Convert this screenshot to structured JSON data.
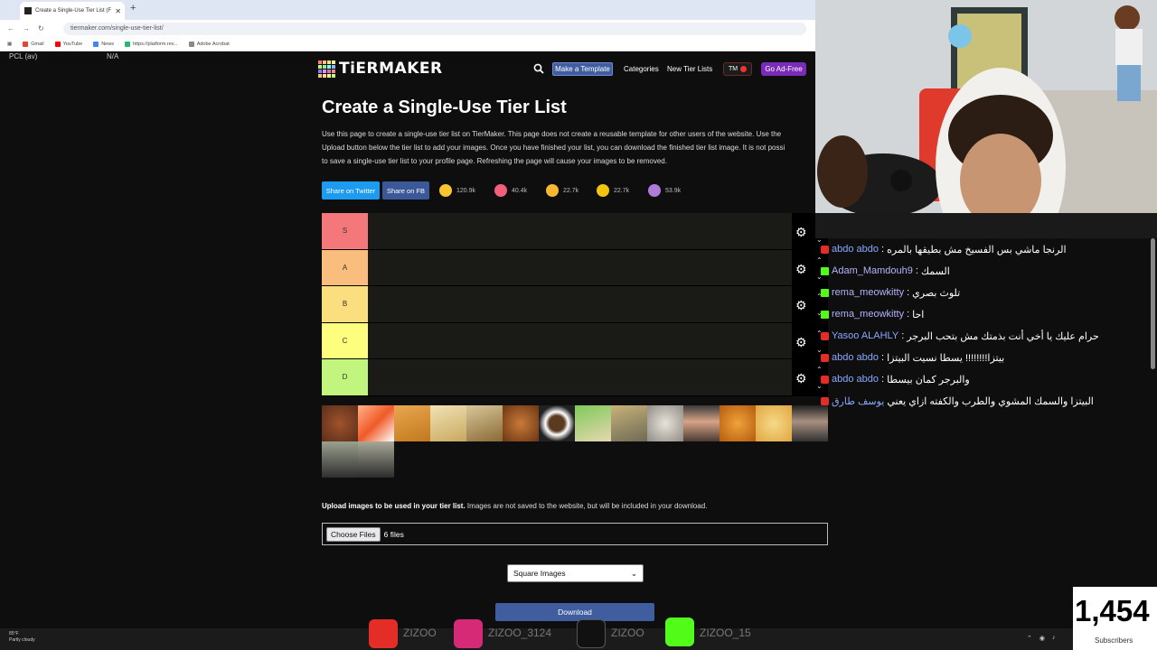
{
  "browser": {
    "tab_title": "Create a Single-Use Tier List (F",
    "new_tab": "+",
    "url": "tiermaker.com/single-use-tier-list/",
    "bookmarks": [
      "Gmail",
      "YouTube",
      "News",
      "https://platform.rev...",
      "Adobe Acrobat"
    ]
  },
  "overlay": {
    "pcl": "PCL (av)",
    "na": "N/A"
  },
  "nav": {
    "logo": "TiERMAKER",
    "make_template": "Make a Template",
    "categories": "Categories",
    "new_tier_lists": "New Tier Lists",
    "tm": "TM",
    "ad_free": "Go Ad-Free"
  },
  "page": {
    "title": "Create a Single-Use Tier List",
    "description": [
      "Use this page to create a single-use tier list on TierMaker. This page does not create a reusable template for other users of the website. Use the",
      "Upload button below the tier list to add your images. Once you have finished your list, you can download the finished tier list image. It is not possi",
      "to save a single-use tier list to your profile page. Refreshing the page will cause your images to be removed."
    ],
    "share_twitter": "Share on Twitter",
    "share_fb": "Share on FB",
    "reactions": [
      {
        "icon": "grin-emoji-icon",
        "count": "120.9k",
        "color": "#f7c531"
      },
      {
        "icon": "heart-eyes-emoji-icon",
        "count": "40.4k",
        "color": "#f25f7a"
      },
      {
        "icon": "laughing-emoji-icon",
        "count": "22.7k",
        "color": "#f7b731"
      },
      {
        "icon": "clapping-hands-icon",
        "count": "22.7k",
        "color": "#f1c40f"
      },
      {
        "icon": "poop-emoji-icon",
        "count": "53.9k",
        "color": "#b07ad9"
      }
    ],
    "tiers": [
      {
        "label": "S",
        "color": "#f4787a"
      },
      {
        "label": "A",
        "color": "#f9bd7d"
      },
      {
        "label": "B",
        "color": "#fbde7d"
      },
      {
        "label": "C",
        "color": "#fdfd7e"
      },
      {
        "label": "D",
        "color": "#c1f57e"
      }
    ],
    "upload_bold": "Upload images to be used in your tier list.",
    "upload_rest": " Images are not saved to the website, but will be included in your download.",
    "choose_files": "Choose Files",
    "files_count": "6 files",
    "shape_select": "Square Images",
    "download": "Download"
  },
  "chat": [
    {
      "platform": "youtube",
      "user": "abdo abdo",
      "text": "الرنجا ماشي بس الفسيخ مش بطيقها بالمره"
    },
    {
      "platform": "kick",
      "user": "Adam_Mamdouh9",
      "text": "السمك"
    },
    {
      "platform": "kick",
      "user": "rema_meowkitty",
      "text": "تلوث بصري"
    },
    {
      "platform": "kick",
      "user": "rema_meowkitty",
      "text": "احا"
    },
    {
      "platform": "youtube",
      "user": "Yasoo ALAHLY",
      "text": "حرام عليك يا أخي أنت بذمتك مش بتحب البرجر"
    },
    {
      "platform": "youtube",
      "user": "abdo abdo",
      "text": "بيتزا!!!!!!!! يسطا نسيت البيتزا"
    },
    {
      "platform": "youtube",
      "user": "abdo abdo",
      "text": "والبرجر كمان بيسطا"
    },
    {
      "platform": "youtube",
      "user": "يوسف طارق",
      "text": "البيتزا والسمك المشوي والطرب والكفته ازاي يعني"
    }
  ],
  "socials": [
    {
      "icon": "youtube-icon",
      "handle": "ZIZOO",
      "color": "#e52d27"
    },
    {
      "icon": "instagram-icon",
      "handle": "ZIZOO_3124",
      "color": "#d62976"
    },
    {
      "icon": "tiktok-icon",
      "handle": "ZIZOO",
      "color": "#111111"
    },
    {
      "icon": "kick-icon",
      "handle": "ZIZOO_15",
      "color": "#53fc18"
    }
  ],
  "subscribers": {
    "count": "1,454",
    "label": "Subscribers"
  },
  "taskbar": {
    "weather_temp": "85°F",
    "weather_desc": "Partly cloudy"
  }
}
